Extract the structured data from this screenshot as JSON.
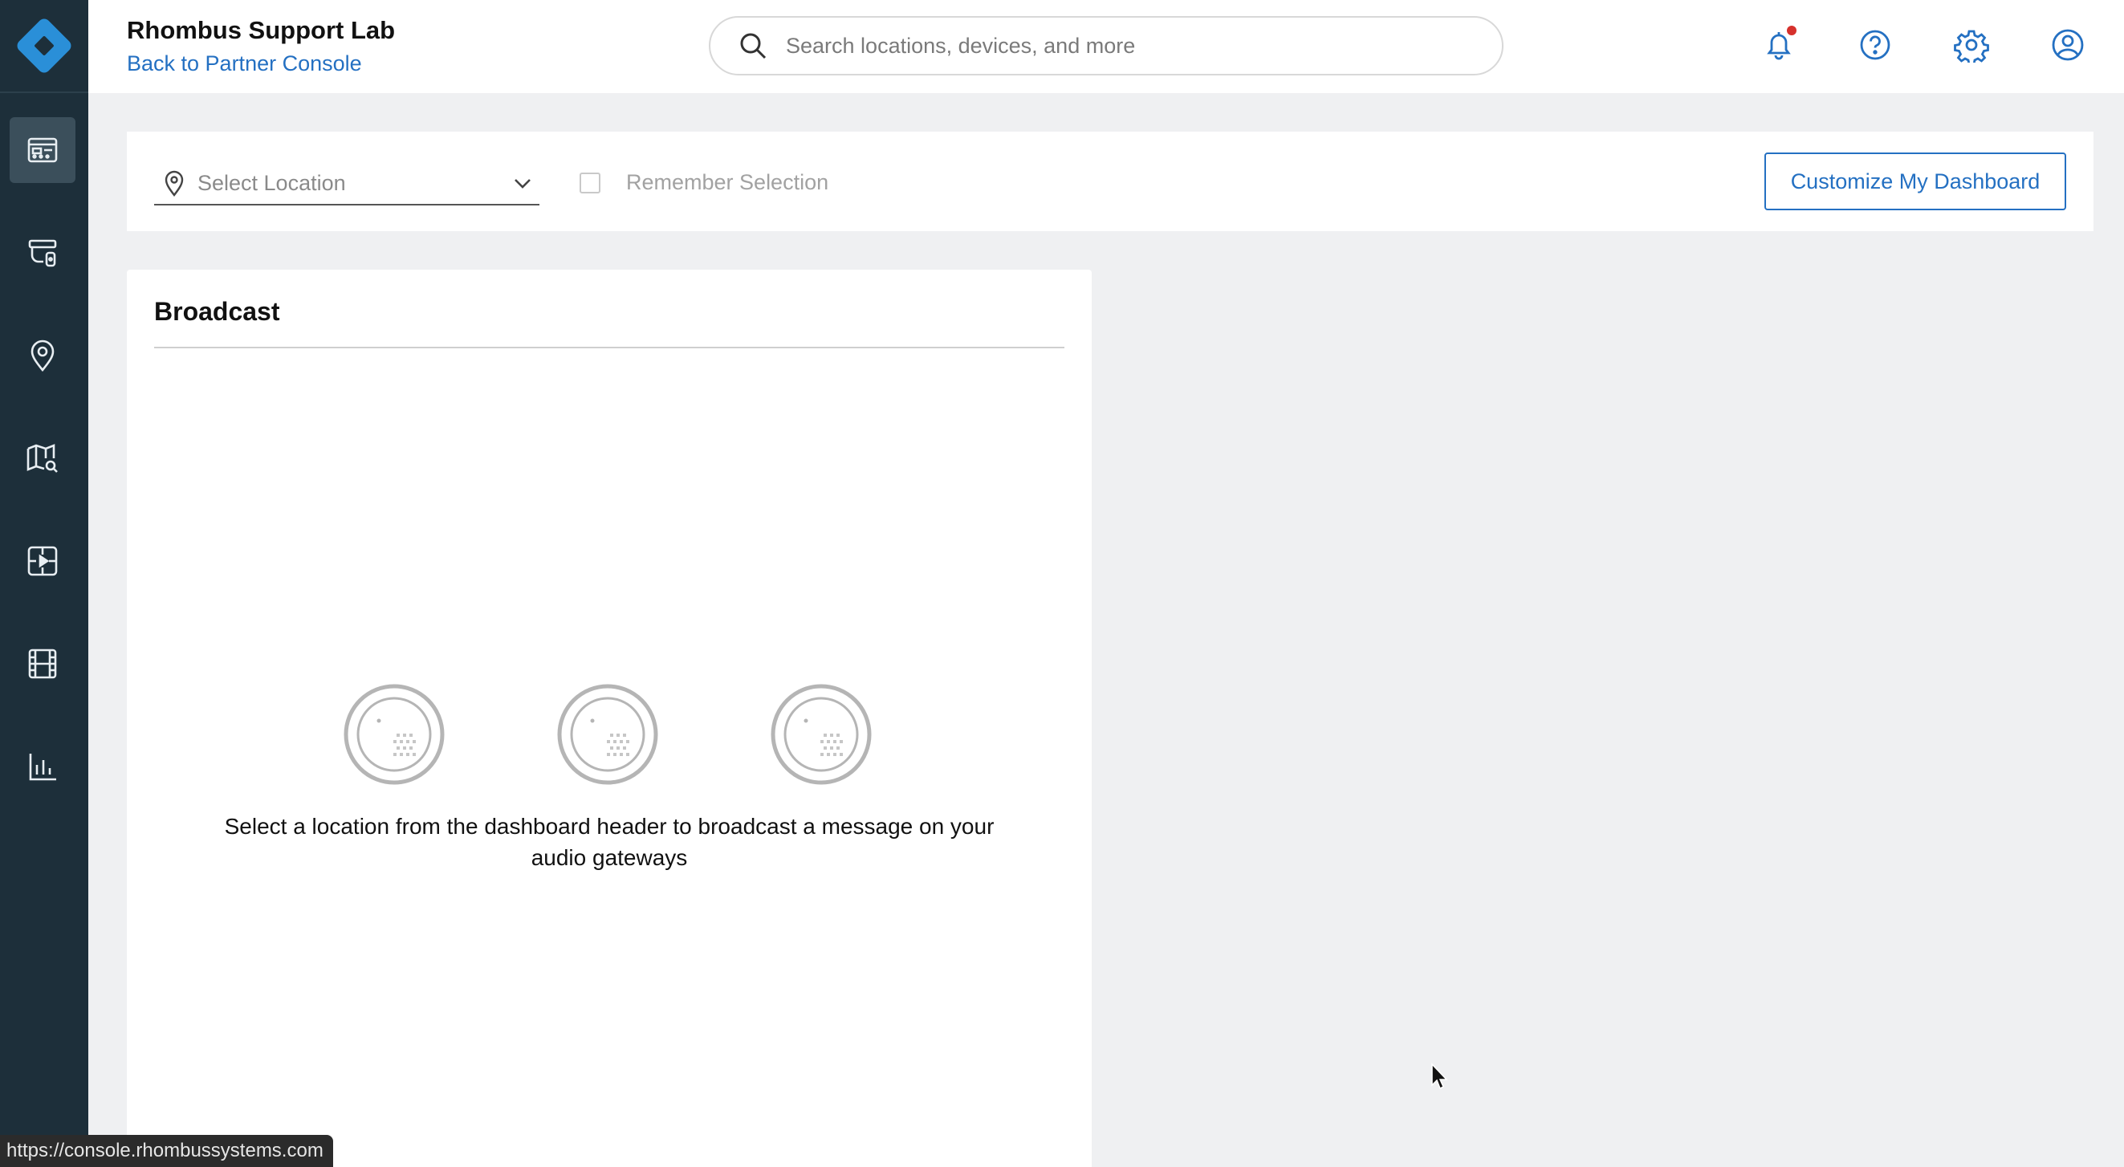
{
  "header": {
    "org_name": "Rhombus Support Lab",
    "back_link": "Back to Partner Console",
    "search_placeholder": "Search locations, devices, and more"
  },
  "sidebar": {
    "items": [
      {
        "name": "dashboard-icon",
        "active": true
      },
      {
        "name": "camera-devices-icon",
        "active": false
      },
      {
        "name": "location-pin-icon",
        "active": false
      },
      {
        "name": "map-search-icon",
        "active": false
      },
      {
        "name": "video-player-icon",
        "active": false
      },
      {
        "name": "film-clips-icon",
        "active": false
      },
      {
        "name": "reports-chart-icon",
        "active": false
      }
    ]
  },
  "filters": {
    "location_placeholder": "Select Location",
    "remember_label": "Remember Selection",
    "customize_label": "Customize My Dashboard"
  },
  "broadcast": {
    "title": "Broadcast",
    "empty_message": "Select a location from the dashboard header to broadcast a message on your audio gateways"
  },
  "statusbar": {
    "url": "https://console.rhombussystems.com"
  },
  "colors": {
    "sidebar_bg": "#1d2f3a",
    "accent": "#2470c2",
    "logo": "#2a8fd8",
    "notification_dot": "#d6312c"
  }
}
